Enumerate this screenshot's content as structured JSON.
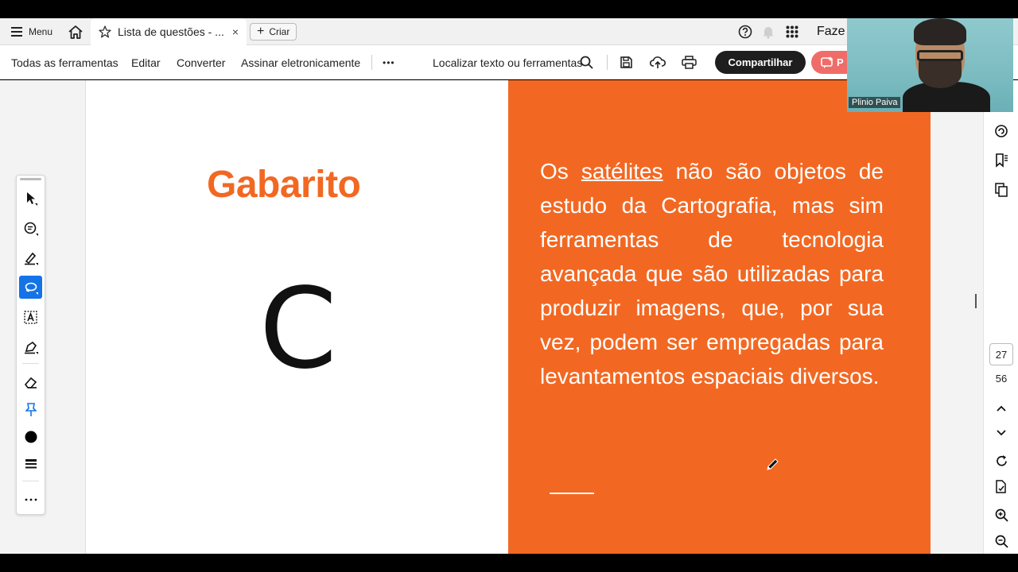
{
  "tabbar": {
    "menu_label": "Menu",
    "tab_title": "Lista de questões - ...",
    "tab_close": "×",
    "criar_label": "Criar",
    "criar_plus": "+",
    "right_text": "Faze"
  },
  "toolbar": {
    "all_tools": "Todas as ferramentas",
    "edit": "Editar",
    "convert": "Converter",
    "sign": "Assinar eletronicamente",
    "more": "•••",
    "find": "Localizar texto ou ferramentas",
    "share": "Compartilhar",
    "red_button": "P"
  },
  "document": {
    "title": "Gabarito",
    "answer": "C",
    "explanation_before": "Os ",
    "explanation_underlined": "satélites",
    "explanation_after": " não são objetos de estudo da Cartografia, mas sim ferramentas de tecnologia avançada que são utilizadas para produzir imagens, que, por sua vez, podem ser empregadas para levantamentos espaciais diversos."
  },
  "navigation": {
    "current_page": "27",
    "total_pages": "56"
  },
  "webcam": {
    "name": "Plinio Paiva"
  },
  "colors": {
    "accent_orange": "#f26822",
    "active_tool": "#1473e6",
    "share_button": "#1e1e1e",
    "red_button": "#f06c68"
  }
}
